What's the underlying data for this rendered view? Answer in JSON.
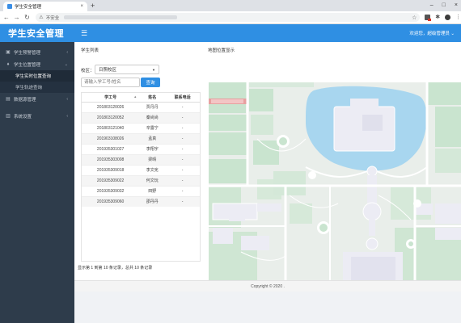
{
  "browser": {
    "tab_title": "学生安全管理",
    "tab_close": "×",
    "new_tab": "+",
    "insecure_label": "不安全",
    "controls": {
      "minimize": "–",
      "maximize": "□",
      "close": "×"
    }
  },
  "app": {
    "logo": "学生安全管理",
    "user_menu": "欢迎您，超级管理员 ⌄",
    "footer": "Copyright © 2020 ."
  },
  "sidebar": {
    "items": [
      {
        "label": "学生预警管理",
        "icon": "warning-icon",
        "glyph": "▣"
      },
      {
        "label": "学生位置管理",
        "icon": "person-icon",
        "glyph": "♦"
      },
      {
        "label": "数据源管理",
        "icon": "database-icon",
        "glyph": "▤"
      },
      {
        "label": "系统设置",
        "icon": "bank-icon",
        "glyph": "▥"
      }
    ],
    "sub_items": [
      "学生实时位置查询",
      "学生轨迹查询"
    ]
  },
  "left_panel": {
    "title": "学生列表",
    "campus_label": "校区：",
    "campus_value": "日照校区",
    "search_placeholder": "请输入学工号/姓名",
    "search_button": "查询",
    "columns": [
      "学工号",
      "姓名",
      "联系电话"
    ],
    "rows": [
      [
        "201803120026",
        "贾丹丹",
        "-"
      ],
      [
        "201803120052",
        "秦尚尚",
        "-"
      ],
      [
        "201803121040",
        "辛露宁",
        "-"
      ],
      [
        "201903108026",
        "孟真",
        "-"
      ],
      [
        "201935301027",
        "李翔宇",
        "-"
      ],
      [
        "201935303008",
        "梁晴",
        "-"
      ],
      [
        "201935309018",
        "李文宪",
        "-"
      ],
      [
        "201935309022",
        "何文玩",
        "-"
      ],
      [
        "201935309032",
        "田野",
        "-"
      ],
      [
        "201935309060",
        "邵丹丹",
        "-"
      ]
    ],
    "pagination": "显示第 1 到第 10 条记录，总共 10 条记录"
  },
  "right_panel": {
    "title": "地图位置显示"
  }
}
